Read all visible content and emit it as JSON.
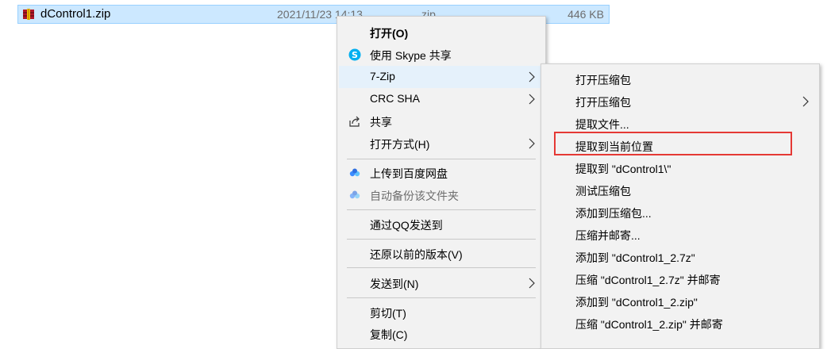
{
  "file": {
    "name": "dControl1.zip",
    "date": "2021/11/23 14:13",
    "type": "zip",
    "size": "446 KB",
    "icon": "winrar-zip-icon"
  },
  "context_menu": {
    "items": [
      {
        "label": "打开(O)",
        "bold": true
      },
      {
        "label": "使用 Skype 共享",
        "icon": "skype-icon"
      },
      {
        "label": "7-Zip",
        "submenu": true,
        "highlighted": true
      },
      {
        "label": "CRC SHA",
        "submenu": true
      },
      {
        "label": "共享",
        "icon": "share-icon"
      },
      {
        "label": "打开方式(H)",
        "submenu": true
      },
      {
        "label": "上传到百度网盘",
        "icon": "baidu-netdisk-icon"
      },
      {
        "label": "自动备份该文件夹",
        "icon": "baidu-netdisk-icon",
        "disabled": true
      },
      {
        "label": "通过QQ发送到"
      },
      {
        "label": "还原以前的版本(V)"
      },
      {
        "label": "发送到(N)",
        "submenu": true
      },
      {
        "label": "剪切(T)"
      },
      {
        "label": "复制(C)"
      }
    ]
  },
  "submenu_7zip": {
    "items": [
      {
        "label": "打开压缩包"
      },
      {
        "label": "打开压缩包",
        "submenu": true
      },
      {
        "label": "提取文件..."
      },
      {
        "label": "提取到当前位置",
        "highlighted": true
      },
      {
        "label": "提取到 \"dControl1\\\""
      },
      {
        "label": "测试压缩包"
      },
      {
        "label": "添加到压缩包..."
      },
      {
        "label": "压缩并邮寄..."
      },
      {
        "label": "添加到 \"dControl1_2.7z\""
      },
      {
        "label": "压缩 \"dControl1_2.7z\" 并邮寄"
      },
      {
        "label": "添加到 \"dControl1_2.zip\""
      },
      {
        "label": "压缩 \"dControl1_2.zip\" 并邮寄"
      }
    ]
  },
  "colors": {
    "selection": "#cce8ff",
    "menu_bg": "#f2f2f2",
    "hover": "#e5f1fb",
    "highlight_box": "#e53935"
  }
}
